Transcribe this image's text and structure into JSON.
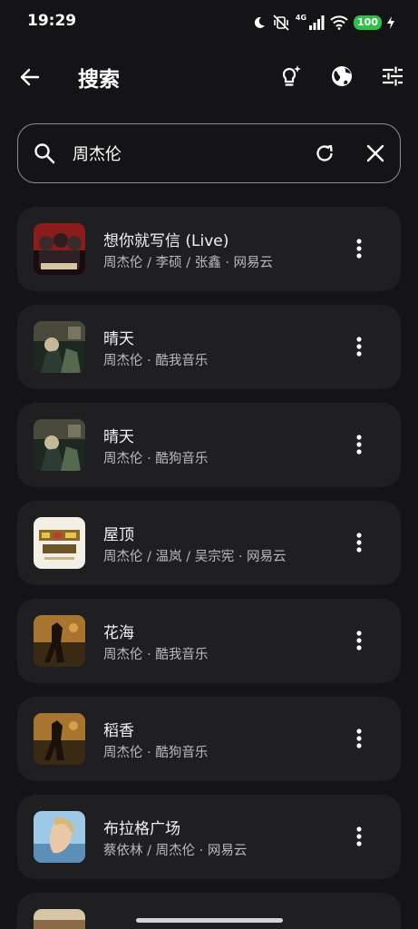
{
  "status_bar": {
    "time": "19:29",
    "network": "4G",
    "battery": "100",
    "icons": [
      "moon-icon",
      "mute-vibrate-icon",
      "signal-icon",
      "wifi-icon",
      "battery-icon",
      "charging-icon"
    ]
  },
  "app_bar": {
    "title": "搜索",
    "actions": [
      "back-arrow-icon",
      "lightbulb-sparkle-icon",
      "globe-icon",
      "tune-icon"
    ]
  },
  "search": {
    "query": "周杰伦",
    "icons": [
      "search-icon",
      "refresh-icon",
      "close-icon"
    ]
  },
  "results": [
    {
      "title": "想你就写信 (Live)",
      "subtitle": "周杰伦 / 李硕 / 张鑫 · 网易云",
      "cover_color": "#8a1c1c"
    },
    {
      "title": "晴天",
      "subtitle": "周杰伦 · 酷我音乐",
      "cover_color": "#2d3b33"
    },
    {
      "title": "晴天",
      "subtitle": "周杰伦 · 酷狗音乐",
      "cover_color": "#2d3b33"
    },
    {
      "title": "屋顶",
      "subtitle": "周杰伦 / 温岚 / 吴宗宪 · 网易云",
      "cover_color": "#f4efe4"
    },
    {
      "title": "花海",
      "subtitle": "周杰伦 · 酷我音乐",
      "cover_color": "#6b4a22"
    },
    {
      "title": "稻香",
      "subtitle": "周杰伦 · 酷狗音乐",
      "cover_color": "#6b4a22"
    },
    {
      "title": "布拉格广场",
      "subtitle": "蔡依林 / 周杰伦 · 网易云",
      "cover_color": "#9ec9e6"
    }
  ],
  "colors": {
    "background": "#141416",
    "card": "#1f1f22",
    "subtitle": "#b9bac0",
    "battery": "#2fbf4a"
  }
}
